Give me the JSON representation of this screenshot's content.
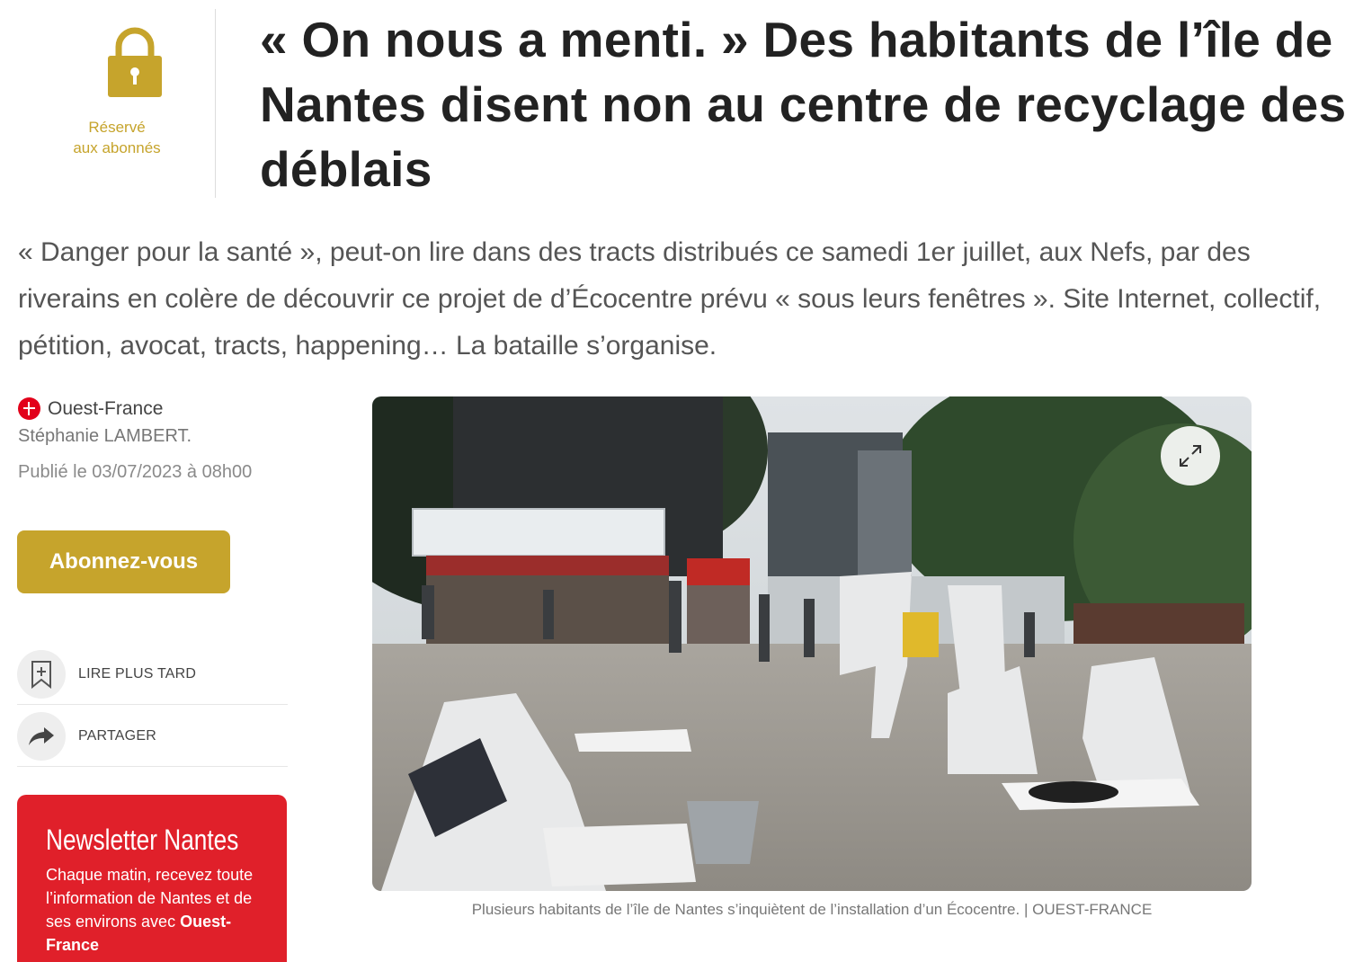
{
  "premium": {
    "line1": "Réservé",
    "line2": "aux abonnés",
    "icon": "lock-icon",
    "color": "#c6a42c"
  },
  "article": {
    "title": "« On nous a menti. » Des habitants de l’île de Nantes disent non au centre de recyclage des déblais",
    "lead": "« Danger pour la santé », peut-on lire dans des tracts distribués ce samedi 1er juillet, aux Nefs, par des  riverains en colère de découvrir ce projet de d’Écocentre prévu « sous leurs fenêtres ». Site Internet, collectif, pétition, avocat, tracts, happening… La bataille s’organise."
  },
  "meta": {
    "source": "Ouest-France",
    "author": "Stéphanie LAMBERT.",
    "published": "Publié le 03/07/2023 à 08h00"
  },
  "actions": {
    "subscribe": "Abonnez-vous",
    "read_later": "LIRE PLUS TARD",
    "share": "PARTAGER"
  },
  "newsletter": {
    "title": "Newsletter Nantes",
    "text": "Chaque matin, recevez toute l’information de Nantes et de ses environs avec ",
    "brand": "Ouest-France",
    "color": "#e0202a"
  },
  "photo": {
    "caption": "Plusieurs habitants de l’île de Nantes s’inquiètent de l’installation d’un Écocentre. | OUEST-FRANCE"
  },
  "colors": {
    "accent_gold": "#c6a42c",
    "brand_red": "#e2001a"
  }
}
